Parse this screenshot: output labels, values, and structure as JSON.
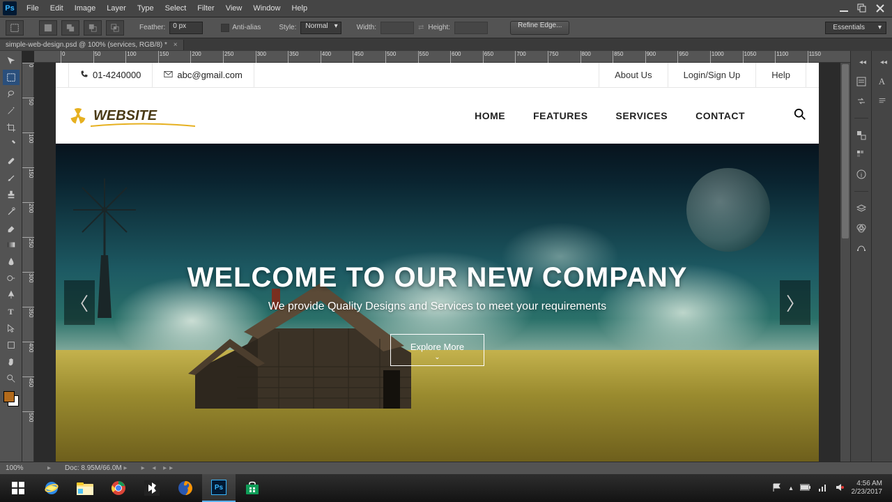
{
  "photoshop": {
    "menus": [
      "File",
      "Edit",
      "Image",
      "Layer",
      "Type",
      "Select",
      "Filter",
      "View",
      "Window",
      "Help"
    ],
    "options": {
      "feather_label": "Feather:",
      "feather_value": "0 px",
      "anti_alias": "Anti-alias",
      "style_label": "Style:",
      "style_value": "Normal",
      "width_label": "Width:",
      "height_label": "Height:",
      "refine_edge": "Refine Edge..."
    },
    "workspace": "Essentials",
    "tab": "simple-web-design.psd @ 100% (services, RGB/8) *",
    "ruler_marks": [
      "0",
      "50",
      "100",
      "150",
      "200",
      "250",
      "300",
      "350",
      "400",
      "450",
      "500",
      "550",
      "600",
      "650",
      "700",
      "750",
      "800",
      "850",
      "900",
      "950",
      "1000",
      "1050",
      "1100",
      "1150"
    ],
    "vruler_marks": [
      "0",
      "50",
      "100",
      "150",
      "200",
      "250",
      "300",
      "350",
      "400",
      "450",
      "500"
    ],
    "status": {
      "zoom": "100%",
      "label": "Doc:",
      "info": "8.95M/66.0M"
    }
  },
  "site": {
    "topbar": {
      "phone": "01-4240000",
      "email": "abc@gmail.com",
      "links": [
        "About Us",
        "Login/Sign Up",
        "Help"
      ]
    },
    "logo_text": "WEBSITE",
    "nav": [
      "HOME",
      "FEATURES",
      "SERVICES",
      "CONTACT"
    ],
    "hero": {
      "headline": "WELCOME TO OUR NEW COMPANY",
      "subtitle": "We provide Quality Designs and Services to meet your requirements",
      "cta": "Explore More"
    }
  },
  "taskbar": {
    "clock_time": "4:56 AM",
    "clock_date": "2/23/2017"
  }
}
